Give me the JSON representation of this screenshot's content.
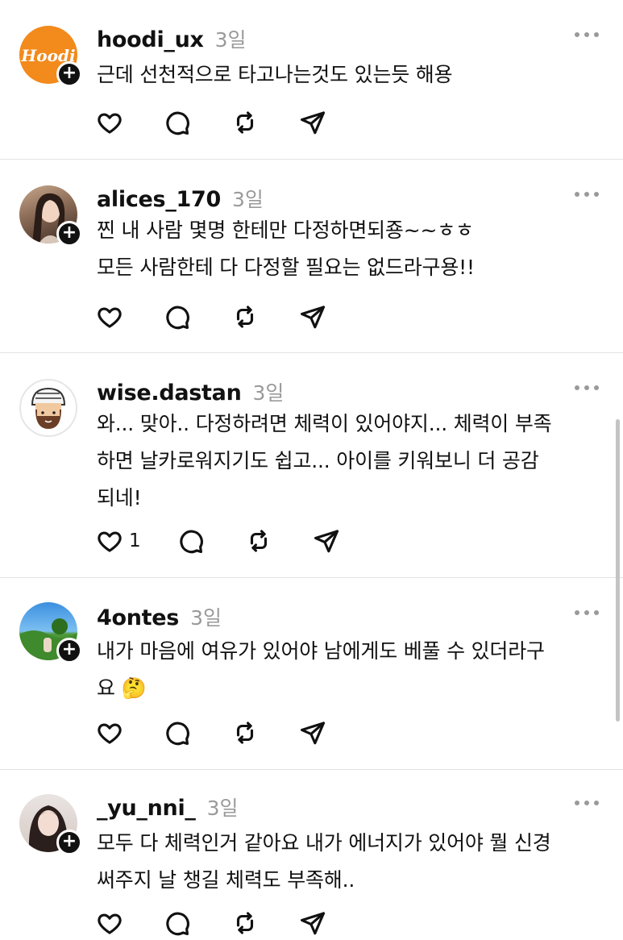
{
  "posts": [
    {
      "username": "hoodi_ux",
      "time": "3일",
      "avatar_text": "Hoodi",
      "lines": [
        "근데 선천적으로 타고나는것도 있는듯 해용"
      ],
      "like_count": ""
    },
    {
      "username": "alices_170",
      "time": "3일",
      "lines": [
        "찐 내 사람 몇명 한테만 다정하면되죵~~ㅎㅎ",
        "모든 사람한테 다 다정할 필요는 없드라구용!!"
      ],
      "like_count": ""
    },
    {
      "username": "wise.dastan",
      "time": "3일",
      "lines": [
        "와... 맞아.. 다정하려면 체력이 있어야지... 체력이 부족",
        "하면 날카로워지기도 쉽고... 아이를 키워보니 더 공감",
        "되네!"
      ],
      "like_count": "1"
    },
    {
      "username": "4ontes",
      "time": "3일",
      "lines": [
        "내가 마음에 여유가 있어야 남에게도 베풀 수 있더라구",
        "요 🤔"
      ],
      "like_count": ""
    },
    {
      "username": "_yu_nni_",
      "time": "3일",
      "lines": [
        "모두 다 체력인거 같아요 내가 에너지가 있어야 뭘 신경",
        "써주지 날 챙길 체력도 부족해.."
      ],
      "like_count": ""
    }
  ],
  "icons": {
    "like": "heart-icon",
    "comment": "comment-icon",
    "repost": "repost-icon",
    "share": "send-icon",
    "more": "more-icon",
    "follow": "plus-icon"
  },
  "colors": {
    "hoodi_avatar": "#f28a1c",
    "time_text": "#9a9a9a",
    "divider": "#e2e2e2"
  }
}
